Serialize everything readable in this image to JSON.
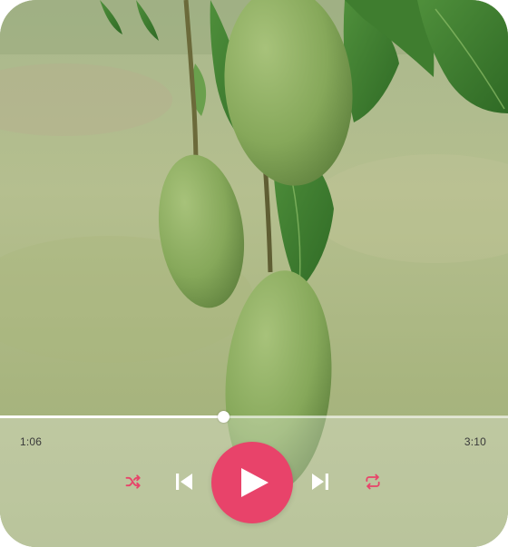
{
  "player": {
    "elapsed": "1:06",
    "duration": "3:10",
    "progress_fraction": 0.44,
    "state": "paused"
  },
  "controls": {
    "shuffle_icon": "shuffle-icon",
    "previous_icon": "skip-previous-icon",
    "play_icon": "play-icon",
    "next_icon": "skip-next-icon",
    "repeat_icon": "repeat-icon"
  },
  "colors": {
    "accent": "#e8436a",
    "icon_white": "#ffffff"
  }
}
